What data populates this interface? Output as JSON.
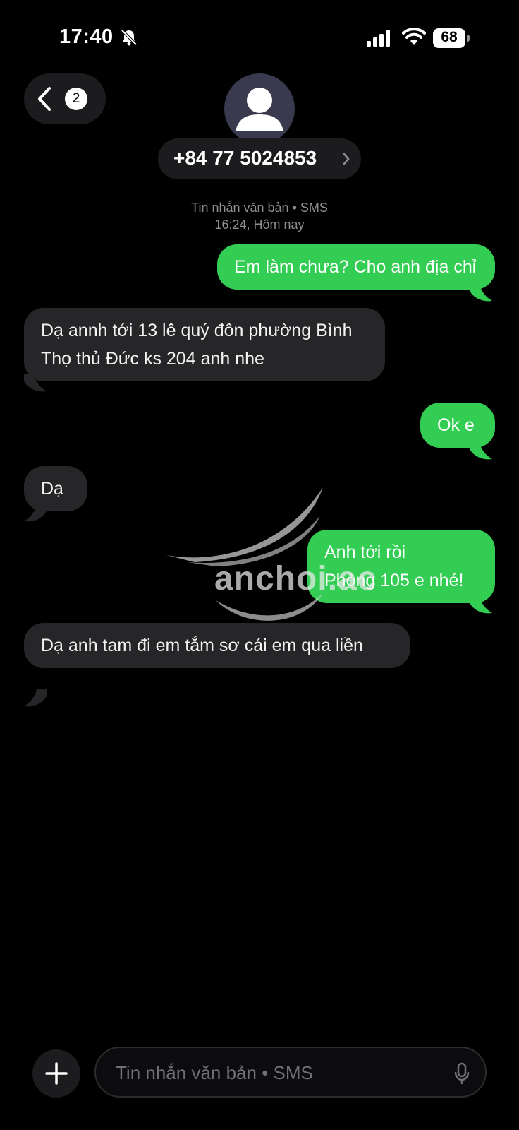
{
  "status_bar": {
    "time": "17:40",
    "battery": "68",
    "icons": [
      "bell-slash-icon",
      "cellular-signal-icon",
      "wifi-icon",
      "battery-icon"
    ]
  },
  "header": {
    "back_badge": "2",
    "contact": "+84 77 5024853",
    "icons": [
      "chevron-left-icon",
      "person-avatar-icon",
      "chevron-right-icon"
    ]
  },
  "thread": {
    "meta_line1": "Tin nhắn văn bản • SMS",
    "meta_line2": "16:24, Hôm nay",
    "messages": [
      {
        "direction": "outgoing",
        "text": "Em làm chưa? Cho anh địa chỉ"
      },
      {
        "direction": "incoming",
        "text": "Dạ annh tới 13 lê quý đôn phường Bình Thọ thủ Đức ks 204 anh nhe"
      },
      {
        "direction": "outgoing",
        "text": "Ok e"
      },
      {
        "direction": "incoming",
        "text": "Dạ"
      },
      {
        "direction": "outgoing",
        "text": "Anh tới rồi\nPhòng 105 e nhé!"
      },
      {
        "direction": "incoming",
        "text": "Dạ anh tam đi em tắm sơ cái em qua liền"
      }
    ]
  },
  "watermark": {
    "text": "anchoi.ac"
  },
  "composer": {
    "placeholder": "Tin nhắn văn bản • SMS",
    "icons": [
      "plus-icon",
      "microphone-icon"
    ]
  },
  "colors": {
    "background": "#000000",
    "incoming_bubble": "#262628",
    "outgoing_bubble": "#33cd54",
    "secondary_text": "#8e8e93"
  }
}
